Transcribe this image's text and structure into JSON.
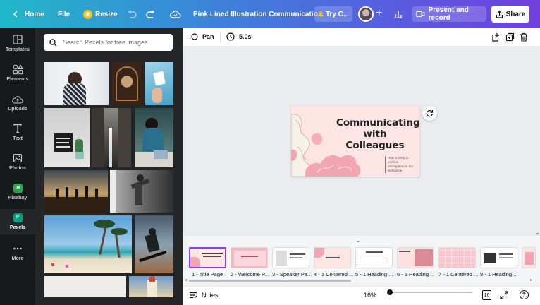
{
  "header": {
    "home_label": "Home",
    "file_label": "File",
    "resize_label": "Resize",
    "doc_title": "Pink Lined Illustration Communicatio...",
    "try_label": "Try C...",
    "present_label": "Present and record",
    "share_label": "Share"
  },
  "rail": {
    "items": [
      {
        "label": "Templates"
      },
      {
        "label": "Elements"
      },
      {
        "label": "Uploads"
      },
      {
        "label": "Text"
      },
      {
        "label": "Photos"
      },
      {
        "label": "Pixabay"
      },
      {
        "label": "Pexels"
      },
      {
        "label": "More"
      }
    ]
  },
  "panel": {
    "search_placeholder": "Search Pexels for free images"
  },
  "editor": {
    "pan_label": "Pan",
    "duration_label": "5.0s"
  },
  "slide": {
    "title_line1": "Communicating",
    "title_line2": "with Colleagues",
    "subtitle": "How to keep a positive atmosphere in the workplace"
  },
  "pages": [
    {
      "label": "1 - Title Page"
    },
    {
      "label": "2 - Welcome P..."
    },
    {
      "label": "3 - Speaker Pa..."
    },
    {
      "label": "4 - 1 Centered ..."
    },
    {
      "label": "5 - 1 Heading ..."
    },
    {
      "label": "6 - 1 Heading ..."
    },
    {
      "label": "7 - 1 Centered ..."
    },
    {
      "label": "8 - 1 Heading ..."
    }
  ],
  "bottom": {
    "notes_label": "Notes",
    "zoom_label": "16%",
    "page_count": "16",
    "zoom_level": 0.16
  },
  "colors": {
    "accent": "#8b3dff",
    "slide_bg": "#fde5e3",
    "slide_pink": "#f2a6b3",
    "rail_bg": "#18191b",
    "panel_bg": "#252627"
  }
}
